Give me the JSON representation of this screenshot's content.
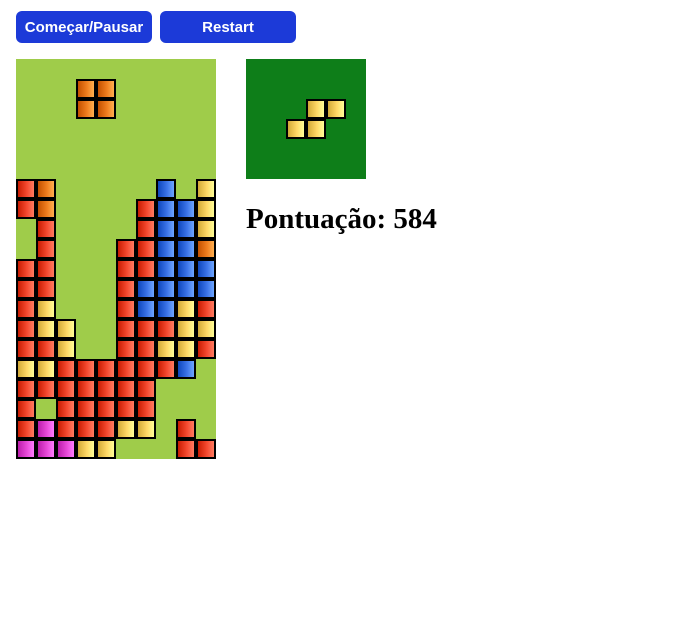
{
  "controls": {
    "start_pause_label": "Começar/Pausar",
    "restart_label": "Restart"
  },
  "score": {
    "label": "Pontuação:",
    "value": "584"
  },
  "colors": {
    "button": "#1c3ad8",
    "board_background": "#9fcc4a",
    "preview_background": "#0e7e19",
    "block_orange": "#f07d1e",
    "block_red": "#f5492f",
    "block_yellow": "#ffd765",
    "block_blue": "#3b73e8",
    "block_pink": "#e84ad8"
  },
  "board": {
    "columns": 10,
    "rows": 20,
    "falling_piece": {
      "shape": "O",
      "color": "orange",
      "cells": [
        [
          3,
          1
        ],
        [
          4,
          1
        ],
        [
          3,
          2
        ],
        [
          4,
          2
        ]
      ]
    },
    "rows_data": [
      "..........",
      "...oo.....",
      "...oo.....",
      "..........",
      "..........",
      "..........",
      "ro.....b.y.",
      "ro....rbbyy",
      ".r....rbbyy",
      ".r...rrbbor",
      "rr...rrbbbo",
      "rr...rbbbbo",
      "ry...rbbyro",
      "ryy..rrryyo",
      "rry..rryyro",
      "yyrrrrrrb..",
      "rrrrrrr....",
      "r.rrrrr....",
      "rprrryy.r..",
      "pppyy...rrr"
    ]
  },
  "next_piece": {
    "shape": "S",
    "color": "yellow",
    "cells": [
      [
        3,
        2
      ],
      [
        4,
        2
      ],
      [
        2,
        3
      ],
      [
        3,
        3
      ]
    ]
  }
}
